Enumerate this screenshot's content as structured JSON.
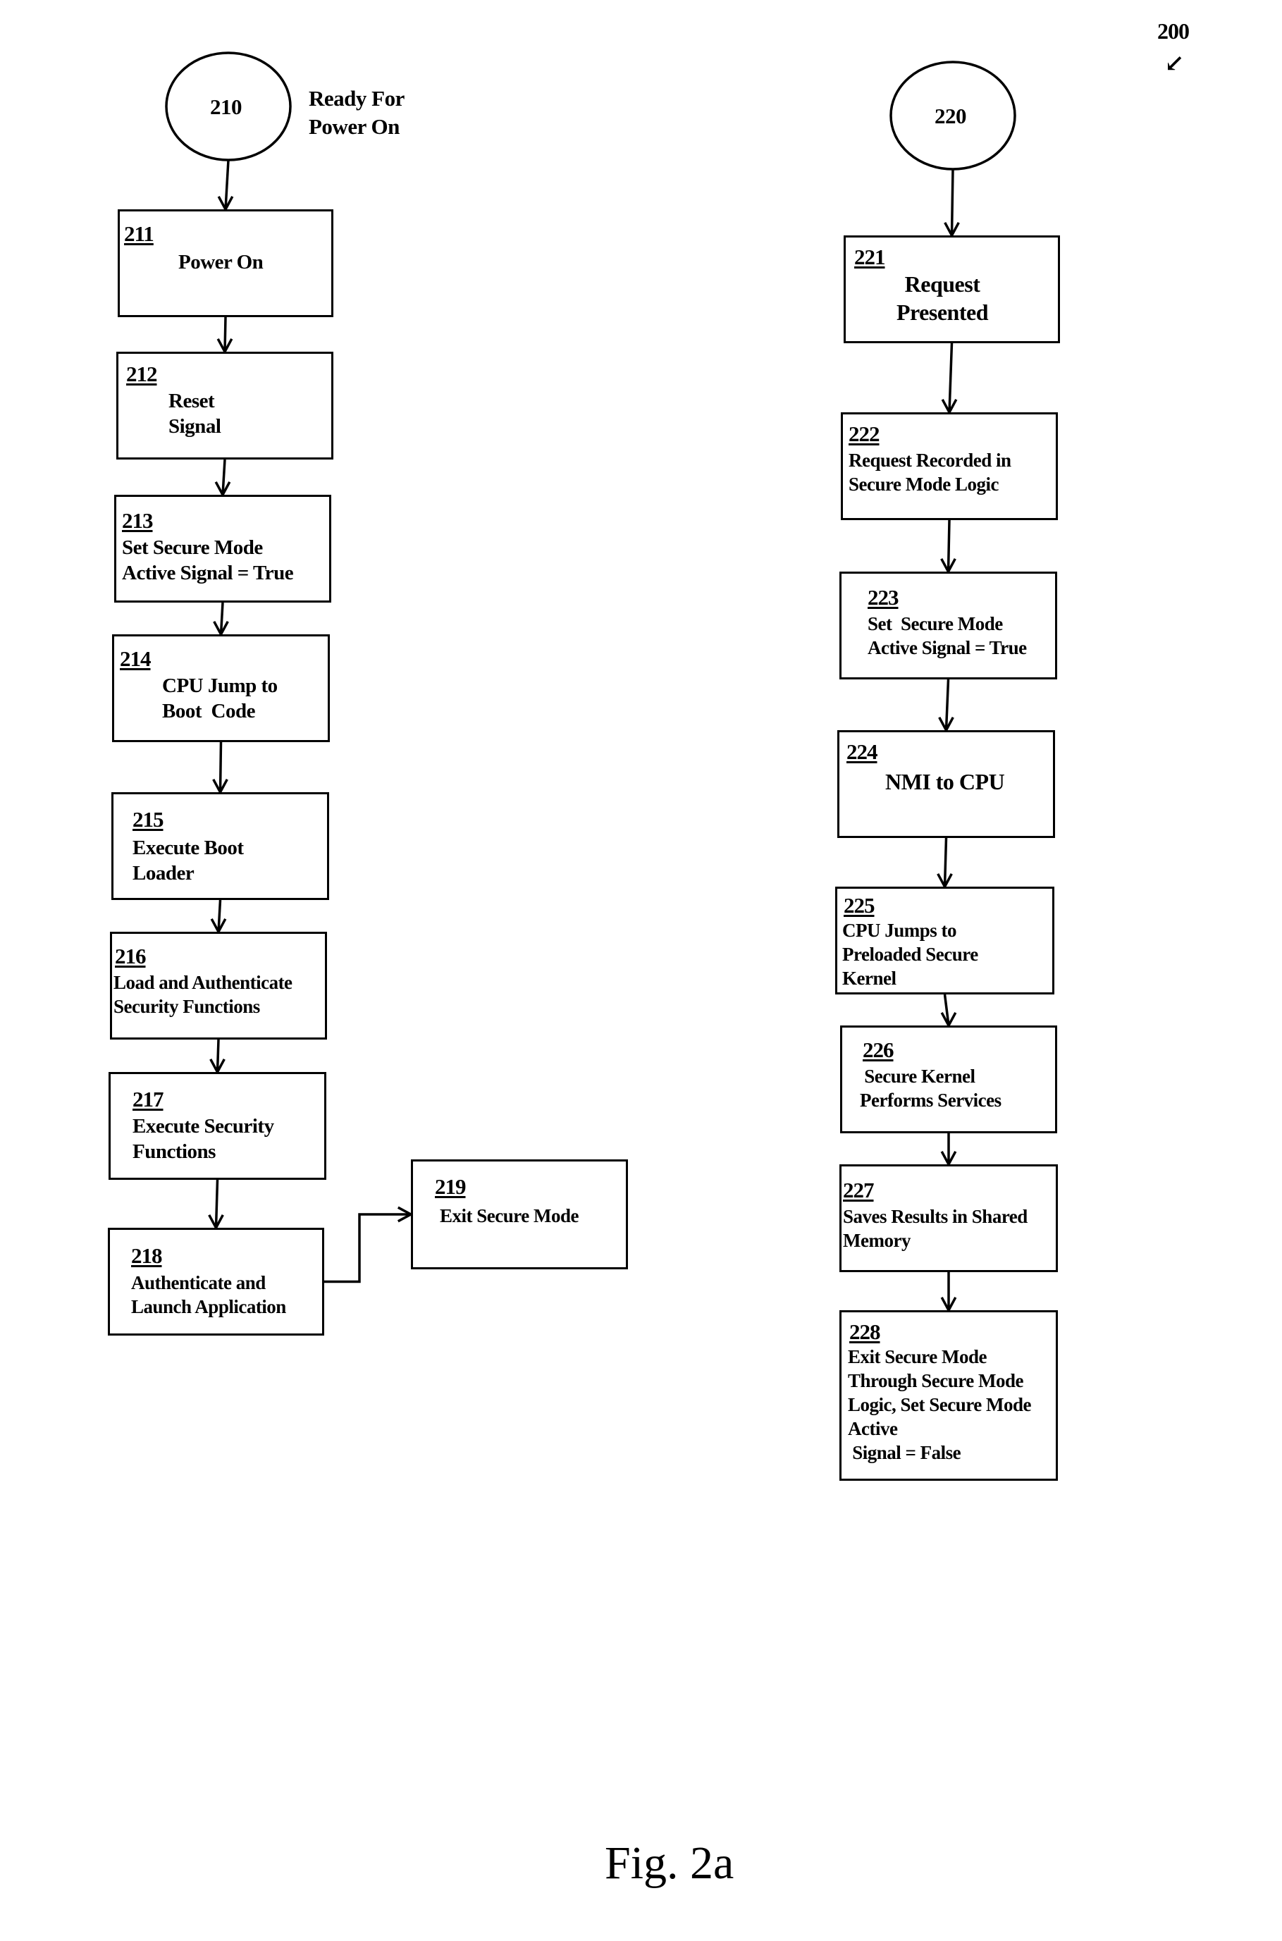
{
  "figure": {
    "caption": "Fig. 2a",
    "reference_number": "200",
    "reference_arrow_icon": "arrow-down-left"
  },
  "left_flow": {
    "start": {
      "id": "210",
      "label": "Ready For\nPower On"
    },
    "steps": [
      {
        "id": "211",
        "text": "Power On"
      },
      {
        "id": "212",
        "text": "Reset\nSignal"
      },
      {
        "id": "213",
        "text": "Set Secure Mode\nActive Signal = True"
      },
      {
        "id": "214",
        "text": "CPU Jump to\nBoot  Code"
      },
      {
        "id": "215",
        "text": "Execute Boot\nLoader"
      },
      {
        "id": "216",
        "text": "Load and Authenticate\nSecurity Functions"
      },
      {
        "id": "217",
        "text": "Execute Security\nFunctions"
      },
      {
        "id": "218",
        "text": "Authenticate and\nLaunch Application"
      },
      {
        "id": "219",
        "text": "Exit Secure Mode"
      }
    ]
  },
  "right_flow": {
    "start": {
      "id": "220",
      "label": ""
    },
    "steps": [
      {
        "id": "221",
        "text": "Request\nPresented"
      },
      {
        "id": "222",
        "text": "Request Recorded in\nSecure Mode Logic"
      },
      {
        "id": "223",
        "text": "Set  Secure Mode\nActive Signal = True"
      },
      {
        "id": "224",
        "text": "NMI to CPU"
      },
      {
        "id": "225",
        "text": "CPU Jumps to\nPreloaded Secure\nKernel"
      },
      {
        "id": "226",
        "text": " Secure Kernel\nPerforms Services"
      },
      {
        "id": "227",
        "text": "Saves Results in Shared\nMemory"
      },
      {
        "id": "228",
        "text": "Exit Secure Mode\nThrough Secure Mode\nLogic, Set Secure Mode\nActive\n Signal = False"
      }
    ]
  },
  "connections": [
    [
      "210",
      "211"
    ],
    [
      "211",
      "212"
    ],
    [
      "212",
      "213"
    ],
    [
      "213",
      "214"
    ],
    [
      "214",
      "215"
    ],
    [
      "215",
      "216"
    ],
    [
      "216",
      "217"
    ],
    [
      "217",
      "218"
    ],
    [
      "218",
      "219"
    ],
    [
      "220",
      "221"
    ],
    [
      "221",
      "222"
    ],
    [
      "222",
      "223"
    ],
    [
      "223",
      "224"
    ],
    [
      "224",
      "225"
    ],
    [
      "225",
      "226"
    ],
    [
      "226",
      "227"
    ],
    [
      "227",
      "228"
    ]
  ]
}
